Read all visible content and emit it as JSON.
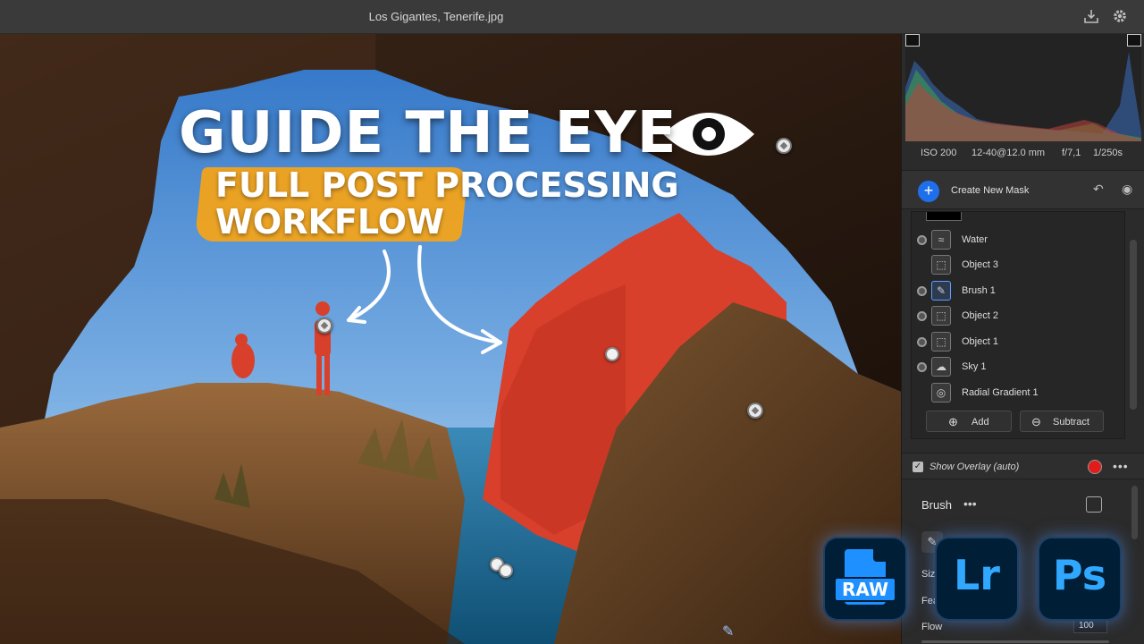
{
  "window": {
    "title": "Los Gigantes, Tenerife.jpg",
    "icons": [
      "export-icon",
      "gear-icon"
    ]
  },
  "thumbnail": {
    "headline": "GUIDE THE EYE",
    "subline_1": "FULL  POST PROCESSING",
    "subline_2": "WORKFLOW",
    "accent_color": "#f2a31b"
  },
  "exif": {
    "iso": "ISO 200",
    "lens": "12-40@12.0 mm",
    "aperture": "f/7,1",
    "shutter": "1/250s"
  },
  "masking": {
    "create_label": "Create New Mask",
    "masks": [
      {
        "name": "Water",
        "icon": "water-mask-icon",
        "visible_toggle": true,
        "selected": false
      },
      {
        "name": "Object 3",
        "icon": "object-mask-icon",
        "visible_toggle": false,
        "selected": false
      },
      {
        "name": "Brush 1",
        "icon": "brush-mask-icon",
        "visible_toggle": true,
        "selected": true
      },
      {
        "name": "Object 2",
        "icon": "object-mask-icon",
        "visible_toggle": true,
        "selected": false
      },
      {
        "name": "Object 1",
        "icon": "object-mask-icon",
        "visible_toggle": true,
        "selected": false
      },
      {
        "name": "Sky 1",
        "icon": "sky-mask-icon",
        "visible_toggle": true,
        "selected": false
      },
      {
        "name": "Radial Gradient 1",
        "icon": "radial-gradient-icon",
        "visible_toggle": false,
        "selected": false
      }
    ],
    "add_label": "Add",
    "subtract_label": "Subtract"
  },
  "overlay": {
    "label": "Show Overlay (auto)",
    "checked": true,
    "color": "#e21b1b"
  },
  "brush": {
    "title": "Brush",
    "size_label": "Size",
    "feather_label": "Feather",
    "flow_label": "Flow",
    "flow_value": "100"
  },
  "badges": [
    "RAW",
    "Lr",
    "Ps"
  ]
}
